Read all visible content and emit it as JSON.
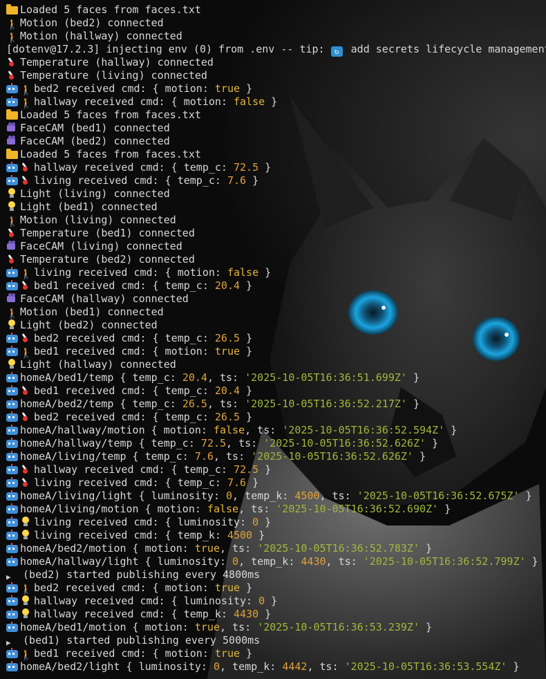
{
  "colors": {
    "text": "#d7d7d7",
    "boolean": "#e5b637",
    "number": "#e0a23a",
    "string": "#a0b83a"
  },
  "lines": [
    {
      "icons": [
        "folder-icon"
      ],
      "parts": [
        {
          "t": "Loaded 5 faces from faces.txt"
        }
      ]
    },
    {
      "icons": [
        "walking-person-icon"
      ],
      "parts": [
        {
          "t": "Motion (bed2) connected"
        }
      ]
    },
    {
      "icons": [
        "walking-person-icon"
      ],
      "parts": [
        {
          "t": "Motion (hallway) connected"
        }
      ]
    },
    {
      "icons": [],
      "parts": [
        {
          "t": "[dotenv@17.2.3] injecting env (0) from .env -- tip: "
        },
        {
          "icon": "refresh-cycle-icon"
        },
        {
          "t": " add secrets lifecycle management"
        }
      ]
    },
    {
      "icons": [
        "thermometer-icon"
      ],
      "parts": [
        {
          "t": "Temperature (hallway) connected"
        }
      ]
    },
    {
      "icons": [
        "thermometer-icon"
      ],
      "parts": [
        {
          "t": "Temperature (living) connected"
        }
      ]
    },
    {
      "icons": [
        "robot-icon",
        "walking-person-icon"
      ],
      "parts": [
        {
          "t": "bed2 received cmd: { motion: "
        },
        {
          "t": "true",
          "c": "kw"
        },
        {
          "t": " }"
        }
      ]
    },
    {
      "icons": [
        "robot-icon",
        "walking-person-icon"
      ],
      "parts": [
        {
          "t": "hallway received cmd: { motion: "
        },
        {
          "t": "false",
          "c": "kw"
        },
        {
          "t": " }"
        }
      ]
    },
    {
      "icons": [
        "folder-icon"
      ],
      "parts": [
        {
          "t": "Loaded 5 faces from faces.txt"
        }
      ]
    },
    {
      "icons": [
        "camera-icon"
      ],
      "parts": [
        {
          "t": "FaceCAM (bed1) connected"
        }
      ]
    },
    {
      "icons": [
        "camera-icon"
      ],
      "parts": [
        {
          "t": "FaceCAM (bed2) connected"
        }
      ]
    },
    {
      "icons": [
        "folder-icon"
      ],
      "parts": [
        {
          "t": "Loaded 5 faces from faces.txt"
        }
      ]
    },
    {
      "icons": [
        "robot-icon",
        "thermometer-icon"
      ],
      "parts": [
        {
          "t": "hallway received cmd: { temp_c: "
        },
        {
          "t": "72.5",
          "c": "num"
        },
        {
          "t": " }"
        }
      ]
    },
    {
      "icons": [
        "robot-icon",
        "thermometer-icon"
      ],
      "parts": [
        {
          "t": "living received cmd: { temp_c: "
        },
        {
          "t": "7.6",
          "c": "num"
        },
        {
          "t": " }"
        }
      ]
    },
    {
      "icons": [
        "light-bulb-icon"
      ],
      "parts": [
        {
          "t": "Light (living) connected"
        }
      ]
    },
    {
      "icons": [
        "light-bulb-icon"
      ],
      "parts": [
        {
          "t": "Light (bed1) connected"
        }
      ]
    },
    {
      "icons": [
        "walking-person-icon"
      ],
      "parts": [
        {
          "t": "Motion (living) connected"
        }
      ]
    },
    {
      "icons": [
        "thermometer-icon"
      ],
      "parts": [
        {
          "t": "Temperature (bed1) connected"
        }
      ]
    },
    {
      "icons": [
        "camera-icon"
      ],
      "parts": [
        {
          "t": "FaceCAM (living) connected"
        }
      ]
    },
    {
      "icons": [
        "thermometer-icon"
      ],
      "parts": [
        {
          "t": "Temperature (bed2) connected"
        }
      ]
    },
    {
      "icons": [
        "robot-icon",
        "walking-person-icon"
      ],
      "parts": [
        {
          "t": "living received cmd: { motion: "
        },
        {
          "t": "false",
          "c": "kw"
        },
        {
          "t": " }"
        }
      ]
    },
    {
      "icons": [
        "robot-icon",
        "thermometer-icon"
      ],
      "parts": [
        {
          "t": "bed1 received cmd: { temp_c: "
        },
        {
          "t": "20.4",
          "c": "num"
        },
        {
          "t": " }"
        }
      ]
    },
    {
      "icons": [
        "camera-icon"
      ],
      "parts": [
        {
          "t": "FaceCAM (hallway) connected"
        }
      ]
    },
    {
      "icons": [
        "walking-person-icon"
      ],
      "parts": [
        {
          "t": "Motion (bed1) connected"
        }
      ]
    },
    {
      "icons": [
        "light-bulb-icon"
      ],
      "parts": [
        {
          "t": "Light (bed2) connected"
        }
      ]
    },
    {
      "icons": [
        "robot-icon",
        "thermometer-icon"
      ],
      "parts": [
        {
          "t": "bed2 received cmd: { temp_c: "
        },
        {
          "t": "26.5",
          "c": "num"
        },
        {
          "t": " }"
        }
      ]
    },
    {
      "icons": [
        "robot-icon",
        "walking-person-icon"
      ],
      "parts": [
        {
          "t": "bed1 received cmd: { motion: "
        },
        {
          "t": "true",
          "c": "kw"
        },
        {
          "t": " }"
        }
      ]
    },
    {
      "icons": [
        "light-bulb-icon"
      ],
      "parts": [
        {
          "t": "Light (hallway) connected"
        }
      ]
    },
    {
      "icons": [
        "robot-icon"
      ],
      "parts": [
        {
          "t": "homeA/bed1/temp { temp_c: "
        },
        {
          "t": "20.4",
          "c": "num"
        },
        {
          "t": ", ts: "
        },
        {
          "t": "'2025-10-05T16:36:51.699Z'",
          "c": "str"
        },
        {
          "t": " }"
        }
      ]
    },
    {
      "icons": [
        "robot-icon",
        "thermometer-icon"
      ],
      "parts": [
        {
          "t": "bed1 received cmd: { temp_c: "
        },
        {
          "t": "20.4",
          "c": "num"
        },
        {
          "t": " }"
        }
      ]
    },
    {
      "icons": [
        "robot-icon"
      ],
      "parts": [
        {
          "t": "homeA/bed2/temp { temp_c: "
        },
        {
          "t": "26.5",
          "c": "num"
        },
        {
          "t": ", ts: "
        },
        {
          "t": "'2025-10-05T16:36:52.217Z'",
          "c": "str"
        },
        {
          "t": " }"
        }
      ]
    },
    {
      "icons": [
        "robot-icon",
        "thermometer-icon"
      ],
      "parts": [
        {
          "t": "bed2 received cmd: { temp_c: "
        },
        {
          "t": "26.5",
          "c": "num"
        },
        {
          "t": " }"
        }
      ]
    },
    {
      "icons": [
        "robot-icon"
      ],
      "parts": [
        {
          "t": "homeA/hallway/motion { motion: "
        },
        {
          "t": "false",
          "c": "kw"
        },
        {
          "t": ", ts: "
        },
        {
          "t": "'2025-10-05T16:36:52.594Z'",
          "c": "str"
        },
        {
          "t": " }"
        }
      ]
    },
    {
      "icons": [
        "robot-icon"
      ],
      "parts": [
        {
          "t": "homeA/hallway/temp { temp_c: "
        },
        {
          "t": "72.5",
          "c": "num"
        },
        {
          "t": ", ts: "
        },
        {
          "t": "'2025-10-05T16:36:52.626Z'",
          "c": "str"
        },
        {
          "t": " }"
        }
      ]
    },
    {
      "icons": [
        "robot-icon"
      ],
      "parts": [
        {
          "t": "homeA/living/temp { temp_c: "
        },
        {
          "t": "7.6",
          "c": "num"
        },
        {
          "t": ", ts: "
        },
        {
          "t": "'2025-10-05T16:36:52.626Z'",
          "c": "str"
        },
        {
          "t": " }"
        }
      ]
    },
    {
      "icons": [
        "robot-icon",
        "thermometer-icon"
      ],
      "parts": [
        {
          "t": "hallway received cmd: { temp_c: "
        },
        {
          "t": "72.5",
          "c": "num"
        },
        {
          "t": " }"
        }
      ]
    },
    {
      "icons": [
        "robot-icon",
        "thermometer-icon"
      ],
      "parts": [
        {
          "t": "living received cmd: { temp_c: "
        },
        {
          "t": "7.6",
          "c": "num"
        },
        {
          "t": " }"
        }
      ]
    },
    {
      "icons": [
        "robot-icon"
      ],
      "parts": [
        {
          "t": "homeA/living/light { luminosity: "
        },
        {
          "t": "0",
          "c": "num"
        },
        {
          "t": ", temp_k: "
        },
        {
          "t": "4500",
          "c": "num"
        },
        {
          "t": ", ts: "
        },
        {
          "t": "'2025-10-05T16:36:52.675Z'",
          "c": "str"
        },
        {
          "t": " }"
        }
      ]
    },
    {
      "icons": [
        "robot-icon"
      ],
      "parts": [
        {
          "t": "homeA/living/motion { motion: "
        },
        {
          "t": "false",
          "c": "kw"
        },
        {
          "t": ", ts: "
        },
        {
          "t": "'2025-10-05T16:36:52.690Z'",
          "c": "str"
        },
        {
          "t": " }"
        }
      ]
    },
    {
      "icons": [
        "robot-icon",
        "light-bulb-icon"
      ],
      "parts": [
        {
          "t": "living received cmd: { luminosity: "
        },
        {
          "t": "0",
          "c": "num"
        },
        {
          "t": " }"
        }
      ]
    },
    {
      "icons": [
        "robot-icon",
        "light-bulb-icon"
      ],
      "parts": [
        {
          "t": "living received cmd: { temp_k: "
        },
        {
          "t": "4500",
          "c": "num"
        },
        {
          "t": " }"
        }
      ]
    },
    {
      "icons": [
        "robot-icon"
      ],
      "parts": [
        {
          "t": "homeA/bed2/motion { motion: "
        },
        {
          "t": "true",
          "c": "kw"
        },
        {
          "t": ", ts: "
        },
        {
          "t": "'2025-10-05T16:36:52.783Z'",
          "c": "str"
        },
        {
          "t": " }"
        }
      ]
    },
    {
      "icons": [
        "robot-icon"
      ],
      "parts": [
        {
          "t": "homeA/hallway/light { luminosity: "
        },
        {
          "t": "0",
          "c": "num"
        },
        {
          "t": ", temp_k: "
        },
        {
          "t": "4430",
          "c": "num"
        },
        {
          "t": ", ts: "
        },
        {
          "t": "'2025-10-05T16:36:52.799Z'",
          "c": "str"
        },
        {
          "t": " }"
        }
      ]
    },
    {
      "icons": [
        "play-arrow-icon"
      ],
      "parts": [
        {
          "t": " (bed2) started publishing every 4800ms"
        }
      ]
    },
    {
      "icons": [
        "robot-icon",
        "walking-person-icon"
      ],
      "parts": [
        {
          "t": "bed2 received cmd: { motion: "
        },
        {
          "t": "true",
          "c": "kw"
        },
        {
          "t": " }"
        }
      ]
    },
    {
      "icons": [
        "robot-icon",
        "light-bulb-icon"
      ],
      "parts": [
        {
          "t": "hallway received cmd: { luminosity: "
        },
        {
          "t": "0",
          "c": "num"
        },
        {
          "t": " }"
        }
      ]
    },
    {
      "icons": [
        "robot-icon",
        "light-bulb-icon"
      ],
      "parts": [
        {
          "t": "hallway received cmd: { temp_k: "
        },
        {
          "t": "4430",
          "c": "num"
        },
        {
          "t": " }"
        }
      ]
    },
    {
      "icons": [
        "robot-icon"
      ],
      "parts": [
        {
          "t": "homeA/bed1/motion { motion: "
        },
        {
          "t": "true",
          "c": "kw"
        },
        {
          "t": ", ts: "
        },
        {
          "t": "'2025-10-05T16:36:53.239Z'",
          "c": "str"
        },
        {
          "t": " }"
        }
      ]
    },
    {
      "icons": [
        "play-arrow-icon"
      ],
      "parts": [
        {
          "t": " (bed1) started publishing every 5000ms"
        }
      ]
    },
    {
      "icons": [
        "robot-icon",
        "walking-person-icon"
      ],
      "parts": [
        {
          "t": "bed1 received cmd: { motion: "
        },
        {
          "t": "true",
          "c": "kw"
        },
        {
          "t": " }"
        }
      ]
    },
    {
      "icons": [
        "robot-icon"
      ],
      "parts": [
        {
          "t": "homeA/bed2/light { luminosity: "
        },
        {
          "t": "0",
          "c": "num"
        },
        {
          "t": ", temp_k: "
        },
        {
          "t": "4442",
          "c": "num"
        },
        {
          "t": ", ts: "
        },
        {
          "t": "'2025-10-05T16:36:53.554Z'",
          "c": "str"
        },
        {
          "t": " }"
        }
      ]
    }
  ]
}
